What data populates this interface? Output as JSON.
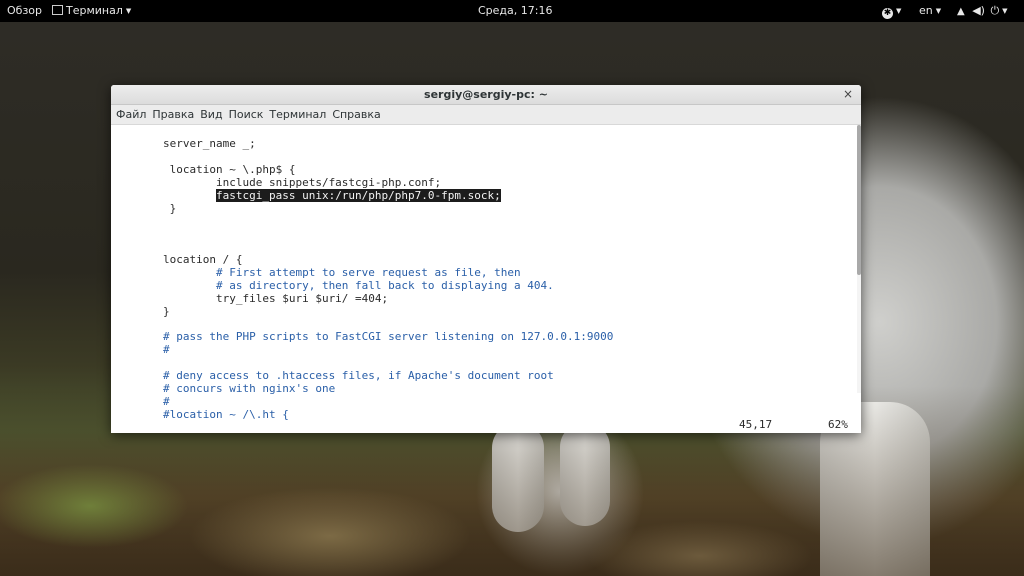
{
  "topbar": {
    "overview": "Обзор",
    "app_menu": "Терминал",
    "clock": "Среда, 17:16",
    "language": "en"
  },
  "window": {
    "title": "sergiy@sergiy-pc: ~"
  },
  "menubar": [
    "Файл",
    "Правка",
    "Вид",
    "Поиск",
    "Терминал",
    "Справка"
  ],
  "editor": {
    "lines": [
      {
        "text": "server_name _;",
        "style": "code"
      },
      {
        "text": " location ~ \\.php$ {",
        "style": "code"
      },
      {
        "text": "        include snippets/fastcgi-php.conf;",
        "style": "code"
      },
      {
        "text": "        fastcgi_pass unix:/run/php/php7.0-fpm.sock;",
        "style": "selected"
      },
      {
        "text": " }",
        "style": "code"
      },
      {
        "text": "location / {",
        "style": "code"
      },
      {
        "text": "        # First attempt to serve request as file, then",
        "style": "comment"
      },
      {
        "text": "        # as directory, then fall back to displaying a 404.",
        "style": "comment"
      },
      {
        "text": "        try_files $uri $uri/ =404;",
        "style": "code"
      },
      {
        "text": "}",
        "style": "code"
      },
      {
        "text": "# pass the PHP scripts to FastCGI server listening on 127.0.0.1:9000",
        "style": "comment"
      },
      {
        "text": "#",
        "style": "comment"
      },
      {
        "text": "# deny access to .htaccess files, if Apache's document root",
        "style": "comment"
      },
      {
        "text": "# concurs with nginx's one",
        "style": "comment"
      },
      {
        "text": "#",
        "style": "comment"
      },
      {
        "text": "#location ~ /\\.ht {",
        "style": "comment"
      }
    ],
    "cursor_position": "45,17",
    "scroll_percent": "62%"
  },
  "colors": {
    "comment": "#2a5fa8",
    "text": "#2b2b2b",
    "selection_bg": "#1c1c1c"
  }
}
